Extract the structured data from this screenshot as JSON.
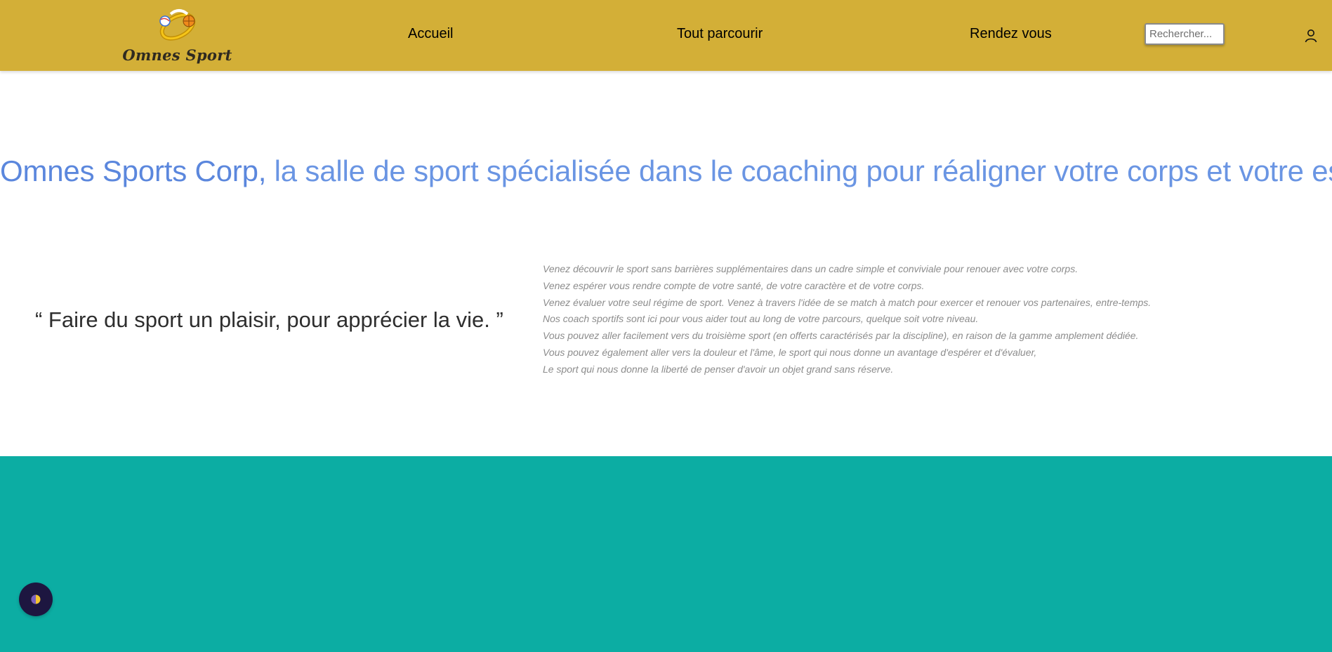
{
  "header": {
    "brand_name": "Omnes Sport",
    "nav": [
      {
        "label": "Accueil"
      },
      {
        "label": "Tout parcourir"
      },
      {
        "label": "Rendez vous"
      }
    ],
    "search": {
      "placeholder": "Rechercher...",
      "value": ""
    },
    "user_icon": "user-icon",
    "background_color": "#d3af37"
  },
  "hero": {
    "brand": "Omnes Sports Corp,",
    "tagline": " la salle de sport spécialisée dans le coaching pour réaligner votre corps et votre esprit",
    "color": "#6a95e3"
  },
  "quote": "“ Faire du sport un plaisir, pour apprécier la vie. ”",
  "description_lines": [
    "Venez découvrir le sport sans barrières supplémentaires dans un cadre simple et conviviale pour renouer avec votre corps.",
    "Venez espérer vous rendre compte de votre santé, de votre caractère et de votre corps.",
    "Venez évaluer votre seul régime de sport. Venez à travers l'idée de se match à match pour exercer et renouer vos partenaires, entre-temps.",
    "Nos coach sportifs sont ici pour vous aider tout au long de votre parcours, quelque soit votre niveau.",
    "Vous pouvez aller facilement vers du troisième sport (en offerts caractérisés par la discipline), en raison de la gamme amplement dédiée.",
    "Vous pouvez également aller vers la douleur et l'âme, le sport qui nous donne un avantage d'espérer et d'évaluer,",
    "Le sport qui nous donne la liberté de penser d'avoir un objet grand sans réserve."
  ],
  "footer": {
    "band_color": "#0cada3",
    "theme_toggle_icon": "half-moon-icon"
  }
}
